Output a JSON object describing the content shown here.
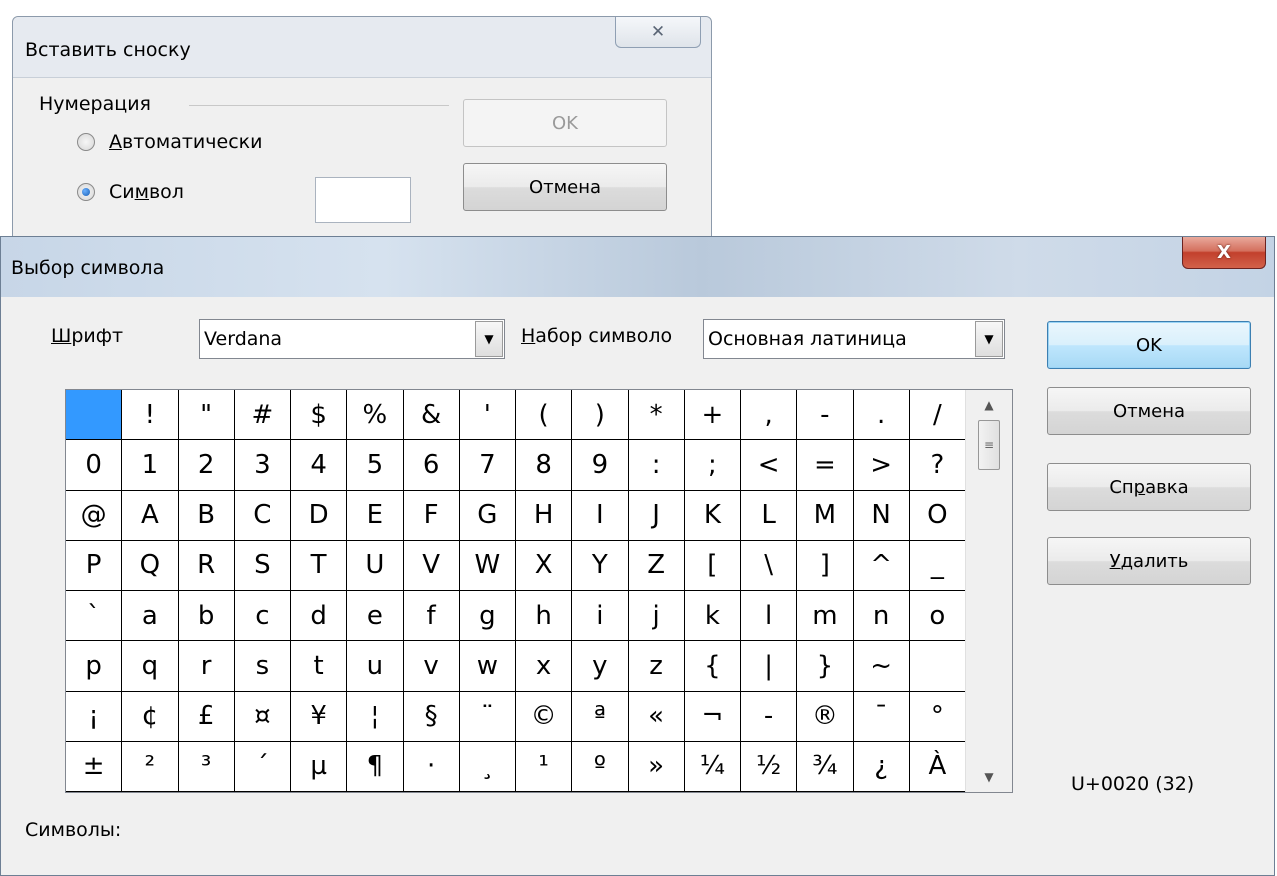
{
  "insert_footnote": {
    "title": "Вставить сноску",
    "close_glyph": "✕",
    "numbering_label": "Нумерация",
    "automatic_pre": "",
    "automatic_mnemonic": "А",
    "automatic_post": "втоматически",
    "symbol_pre": "Си",
    "symbol_mnemonic": "м",
    "symbol_post": "вол",
    "ok_label": "OK",
    "cancel_label": "Отмена"
  },
  "special_chars": {
    "title": "Выбор символа",
    "close_glyph": "X",
    "font_label_mnemonic": "Ш",
    "font_label_rest": "рифт",
    "font_value": "Verdana",
    "subset_label_mnemonic": "Н",
    "subset_label_rest": "абор символо",
    "subset_value": "Основная латиница",
    "ok_label": "OK",
    "cancel_label": "Отмена",
    "help_pre": "Сп",
    "help_mnemonic": "р",
    "help_post": "авка",
    "delete_mnemonic": "У",
    "delete_post": "далить",
    "unicode_readout": "U+0020 (32)",
    "symbols_label": "Символы:",
    "selected_index": 0,
    "characters": [
      " ",
      "!",
      "\"",
      "#",
      "$",
      "%",
      "&",
      "'",
      "(",
      ")",
      "*",
      "+",
      ",",
      "-",
      ".",
      "/",
      "0",
      "1",
      "2",
      "3",
      "4",
      "5",
      "6",
      "7",
      "8",
      "9",
      ":",
      ";",
      "<",
      "=",
      ">",
      "?",
      "@",
      "A",
      "B",
      "C",
      "D",
      "E",
      "F",
      "G",
      "H",
      "I",
      "J",
      "K",
      "L",
      "M",
      "N",
      "O",
      "P",
      "Q",
      "R",
      "S",
      "T",
      "U",
      "V",
      "W",
      "X",
      "Y",
      "Z",
      "[",
      "\\",
      "]",
      "^",
      "_",
      "`",
      "a",
      "b",
      "c",
      "d",
      "e",
      "f",
      "g",
      "h",
      "i",
      "j",
      "k",
      "l",
      "m",
      "n",
      "o",
      "p",
      "q",
      "r",
      "s",
      "t",
      "u",
      "v",
      "w",
      "x",
      "y",
      "z",
      "{",
      "|",
      "}",
      "~",
      " ",
      "¡",
      "¢",
      "£",
      "¤",
      "¥",
      "¦",
      "§",
      "¨",
      "©",
      "ª",
      "«",
      "¬",
      "-",
      "®",
      "¯",
      "°",
      "±",
      "²",
      "³",
      "´",
      "µ",
      "¶",
      "·",
      "¸",
      "¹",
      "º",
      "»",
      "¼",
      "½",
      "¾",
      "¿",
      "À"
    ]
  }
}
